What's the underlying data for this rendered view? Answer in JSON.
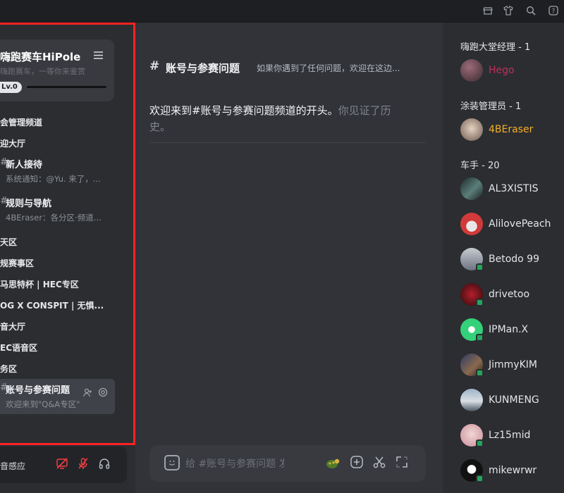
{
  "topbar": {
    "icons": [
      "shop-icon",
      "shirt-icon",
      "search-icon",
      "help-icon"
    ]
  },
  "sidebar": {
    "server_name": "嗨跑赛车HiPole",
    "server_sub": "嗨跑赛车，一等你来鉴赏",
    "level": "Lv.0",
    "categories": [
      "会管理频道",
      "迎大厅",
      "天区",
      "规赛事区",
      "马思特杯 | HEC专区",
      "OG X CONSPIT | 无惧...",
      "音大厅",
      "EC语音区",
      "务区"
    ],
    "channels": [
      {
        "prefix": "#",
        "name": "新人接待",
        "preview": "系统通知：@Yu. 来了，..."
      },
      {
        "prefix": "#",
        "name": "规则与导航",
        "preview": "4BEraser：各分区·频道..."
      }
    ],
    "active_channel": {
      "prefix": "#",
      "name": "账号与参赛问题",
      "preview": "欢迎来到\"Q&A专区\""
    },
    "voice_panel": {
      "label": "音感应"
    }
  },
  "main": {
    "hash": "#",
    "channel_name": "账号与参赛问题",
    "topic": "如果你遇到了任何问题，欢迎在这边...",
    "welcome_main": "欢迎来到#账号与参赛问题频道的开头。",
    "welcome_faded": "你见证了历史。",
    "composer_placeholder": "给 #账号与参赛问题 发..."
  },
  "members": {
    "groups": [
      {
        "title": "嗨跑大堂经理 - 1",
        "members": [
          {
            "name": "Hego",
            "color": "#c0305b",
            "online": false
          }
        ]
      },
      {
        "title": "涂装管理员 - 1",
        "members": [
          {
            "name": "4BEraser",
            "color": "#f5b026",
            "online": false
          }
        ]
      },
      {
        "title": "车手 - 20",
        "members": [
          {
            "name": "AL3XISTIS",
            "color": "#e3e5e8",
            "online": false
          },
          {
            "name": "AlilovePeach",
            "color": "#e3e5e8",
            "online": false
          },
          {
            "name": "Betodo 99",
            "color": "#e3e5e8",
            "online": true
          },
          {
            "name": "drivetoo",
            "color": "#e3e5e8",
            "online": true
          },
          {
            "name": "IPMan.X",
            "color": "#e3e5e8",
            "online": true
          },
          {
            "name": "JimmyKIM",
            "color": "#e3e5e8",
            "online": true
          },
          {
            "name": "KUNMENG",
            "color": "#e3e5e8",
            "online": false
          },
          {
            "name": "Lz15mid",
            "color": "#e3e5e8",
            "online": true
          },
          {
            "name": "mikewrwr",
            "color": "#e3e5e8",
            "online": true
          }
        ]
      }
    ]
  },
  "colors": {
    "accent_red": "#ff2222",
    "online": "#23a55a"
  }
}
